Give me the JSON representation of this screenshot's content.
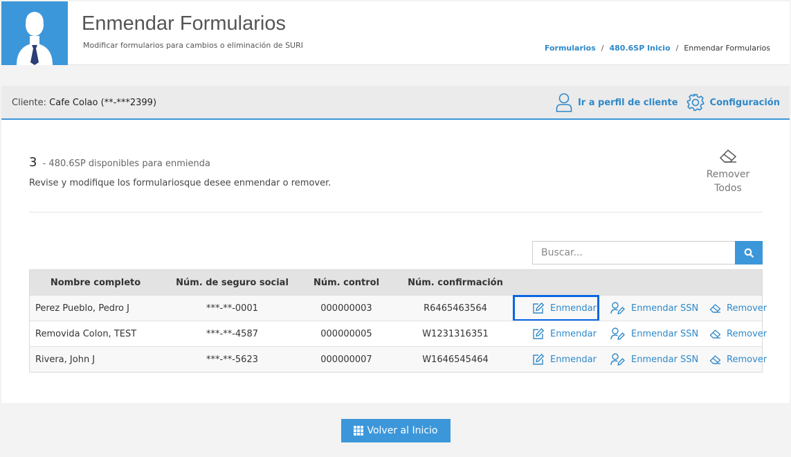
{
  "header": {
    "title": "Enmendar Formularios",
    "subtitle": "Modificar formularios para cambios o eliminación de SURI",
    "breadcrumb": {
      "item1": "Formularios",
      "item2": "480.6SP Inicio",
      "current": "Enmendar Formularios",
      "separator": "/"
    }
  },
  "client": {
    "label": "Cliente:",
    "name": "Cafe Colao (**-***2399)",
    "profile_link": "Ir a perfil de cliente",
    "config_link": "Configuración"
  },
  "summary": {
    "count": "3",
    "count_text": "- 480.6SP disponibles para enmienda",
    "instructions": "Revise y modifique los formulariosque desee enmendar o remover.",
    "remove_all_line1": "Remover",
    "remove_all_line2": "Todos"
  },
  "search": {
    "placeholder": "Buscar..."
  },
  "table": {
    "headers": {
      "name": "Nombre completo",
      "ssn": "Núm. de seguro social",
      "control": "Núm. control",
      "confirmation": "Núm. confirmación"
    },
    "actions": {
      "amend": "Enmendar",
      "amend_ssn": "Enmendar SSN",
      "remove": "Remover"
    },
    "rows": [
      {
        "name": "Perez Pueblo, Pedro J",
        "ssn": "***-**-0001",
        "control": "000000003",
        "confirmation": "R6465463564"
      },
      {
        "name": "Removida Colon, TEST",
        "ssn": "***-**-4587",
        "control": "000000005",
        "confirmation": "W1231316351"
      },
      {
        "name": "Rivera, John J",
        "ssn": "***-**-5623",
        "control": "000000007",
        "confirmation": "W1646545464"
      }
    ]
  },
  "footer": {
    "home_button": "Volver al Inicio"
  },
  "colors": {
    "accent": "#3c97da",
    "link": "#2e88c9",
    "highlight": "#0a66e4"
  }
}
